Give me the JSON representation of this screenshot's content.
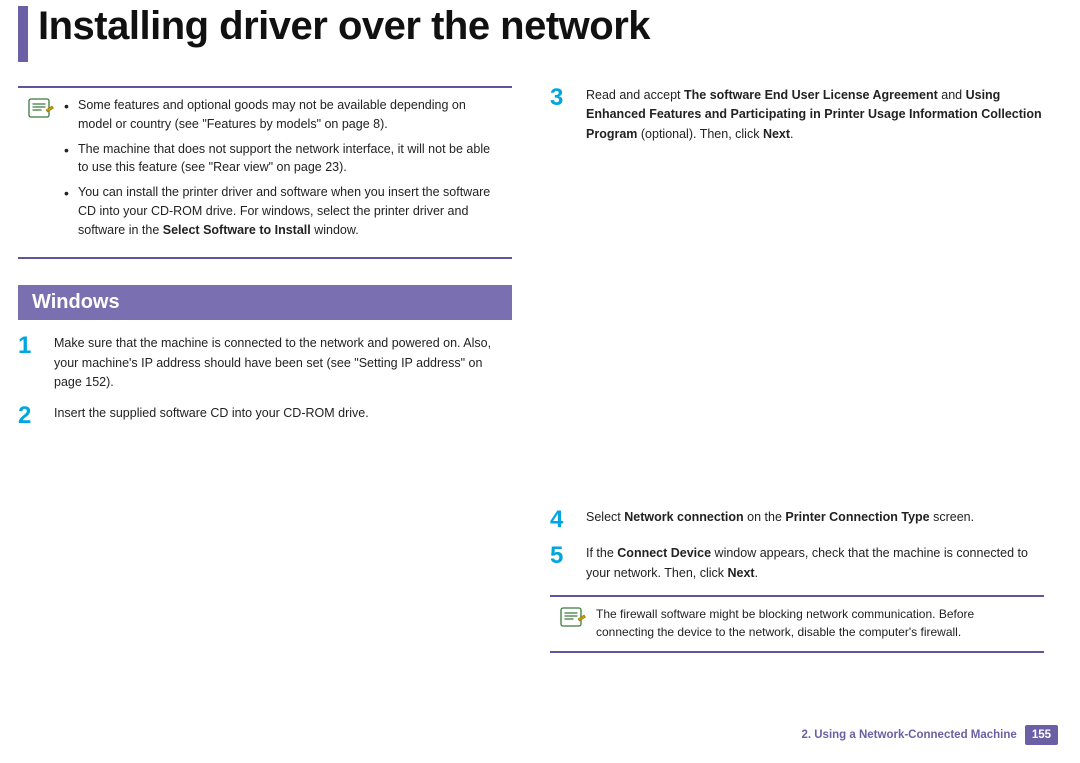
{
  "title": "Installing driver over the network",
  "info_top": {
    "bullets": [
      {
        "pre": "Some features and optional goods may not be available depending on model or country (see \"Features by models\" on page 8).",
        "bold": "",
        "post": ""
      },
      {
        "pre": "The machine that does not support the network interface, it will not be able to use this feature (see \"Rear view\" on page 23).",
        "bold": "",
        "post": ""
      },
      {
        "pre": "You can install the printer driver and software when you insert the software CD into your CD-ROM drive. For windows, select the printer driver and software in the ",
        "bold": "Select Software to Install",
        "post": " window."
      }
    ]
  },
  "section_header": "Windows",
  "left_steps": [
    {
      "num": "1",
      "pre": "Make sure that the machine is connected to the network and powered on. Also, your machine's IP address should have been set (see \"Setting IP address\" on page 152).",
      "bold": "",
      "post": ""
    },
    {
      "num": "2",
      "pre": "Insert the supplied software CD into your CD-ROM drive.",
      "bold": "",
      "post": ""
    }
  ],
  "right_steps": [
    {
      "num": "3",
      "segments": [
        {
          "t": "Read and accept ",
          "b": false
        },
        {
          "t": "The software End User License Agreement",
          "b": true
        },
        {
          "t": " and ",
          "b": false
        },
        {
          "t": "Using Enhanced Features and Participating in Printer Usage Information Collection Program",
          "b": true
        },
        {
          "t": " (optional). Then, click ",
          "b": false
        },
        {
          "t": "Next",
          "b": true
        },
        {
          "t": ".",
          "b": false
        }
      ]
    },
    {
      "num": "4",
      "segments": [
        {
          "t": "Select ",
          "b": false
        },
        {
          "t": "Network connection",
          "b": true
        },
        {
          "t": " on the ",
          "b": false
        },
        {
          "t": "Printer Connection Type",
          "b": true
        },
        {
          "t": " screen.",
          "b": false
        }
      ]
    },
    {
      "num": "5",
      "segments": [
        {
          "t": "If the ",
          "b": false
        },
        {
          "t": "Connect Device",
          "b": true
        },
        {
          "t": " window appears, check that the machine is connected to your network. Then, click ",
          "b": false
        },
        {
          "t": "Next",
          "b": true
        },
        {
          "t": ".",
          "b": false
        }
      ]
    }
  ],
  "info_bottom": "The firewall software might be blocking network communication. Before connecting the device to the network, disable the computer's firewall.",
  "footer": {
    "chapter": "2.  Using a Network-Connected Machine",
    "page": "155"
  }
}
